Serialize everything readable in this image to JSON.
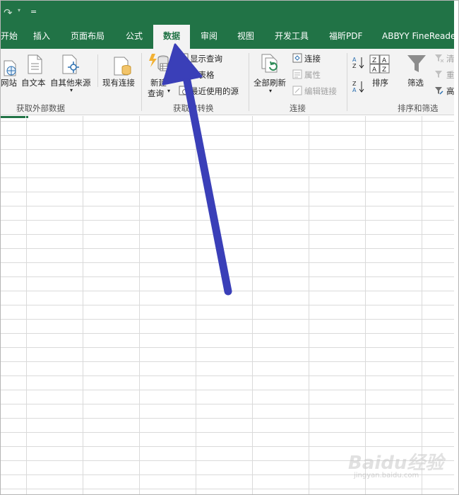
{
  "qat": {
    "redo_icon": "redo-icon",
    "customize_icon": "customize-qat-icon",
    "customize_glyph": "="
  },
  "tabs": [
    {
      "label": "开始"
    },
    {
      "label": "插入"
    },
    {
      "label": "页面布局"
    },
    {
      "label": "公式"
    },
    {
      "label": "数据",
      "active": true
    },
    {
      "label": "审阅"
    },
    {
      "label": "视图"
    },
    {
      "label": "开发工具"
    },
    {
      "label": "福昕PDF"
    },
    {
      "label": "ABBYY FineReader"
    }
  ],
  "ribbon": {
    "get_external": {
      "web": "网站",
      "text": "自文本",
      "other": "自其他来源",
      "existing": "现有连接",
      "group_label": "获取外部数据"
    },
    "get_transform": {
      "new_query_line1": "新建",
      "new_query_line2": "查询",
      "show_queries": "显示查询",
      "from_table": "从表格",
      "recent_sources": "最近使用的源",
      "group_label": "获取和转换"
    },
    "connections": {
      "refresh_all": "全部刷新",
      "connections": "连接",
      "properties": "属性",
      "edit_links": "编辑链接",
      "group_label": "连接"
    },
    "sort_filter": {
      "sort": "排序",
      "filter": "筛选",
      "clear": "清",
      "reapply": "重",
      "advanced": "高",
      "group_label": "排序和筛选"
    }
  },
  "annotation": {
    "color": "#3a3fb8",
    "points_to": "数据"
  },
  "watermark": {
    "main": "Baidu经验",
    "sub": "jingyan.baidu.com"
  },
  "colors": {
    "excel_green": "#217346",
    "ribbon_bg": "#f3f3f3",
    "arrow": "#3a3fb8"
  }
}
